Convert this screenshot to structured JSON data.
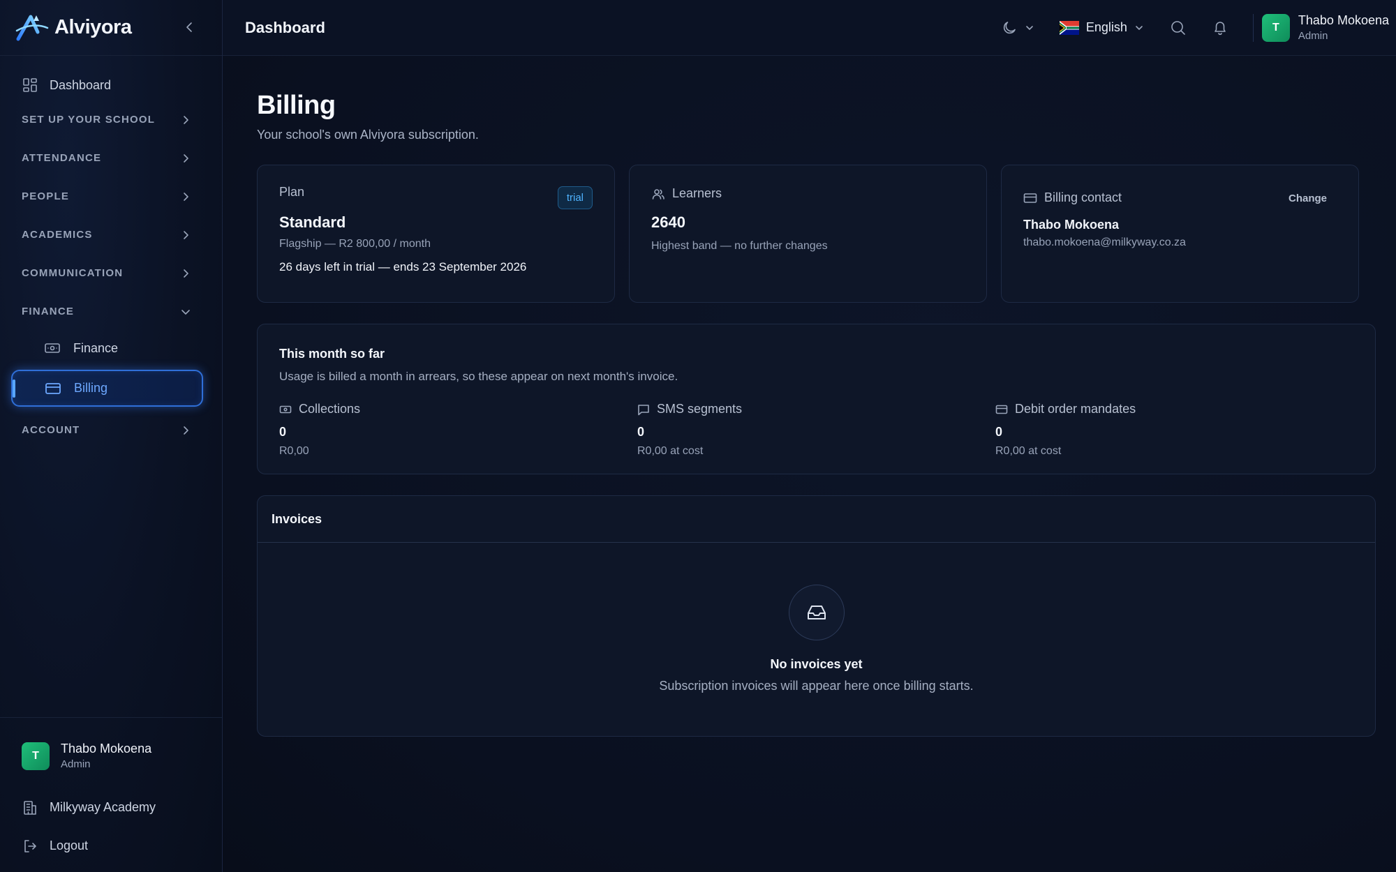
{
  "brand": {
    "name": "Alviyora"
  },
  "topbar": {
    "title": "Dashboard",
    "language": "English"
  },
  "user": {
    "name": "Thabo Mokoena",
    "role": "Admin",
    "initial": "T"
  },
  "sidebar": {
    "dashboard": "Dashboard",
    "sections": [
      {
        "label": "SET UP YOUR SCHOOL"
      },
      {
        "label": "ATTENDANCE"
      },
      {
        "label": "PEOPLE"
      },
      {
        "label": "ACADEMICS"
      },
      {
        "label": "COMMUNICATION"
      },
      {
        "label": "FINANCE"
      },
      {
        "label": "ACCOUNT"
      }
    ],
    "finance_items": [
      {
        "label": "Finance"
      },
      {
        "label": "Billing"
      }
    ],
    "footer": {
      "school": "Milkyway Academy",
      "logout": "Logout"
    }
  },
  "page": {
    "title": "Billing",
    "subtitle": "Your school's own Alviyora subscription."
  },
  "plan": {
    "label": "Plan",
    "badge": "trial",
    "name": "Standard",
    "price": "Flagship — R2 800,00 / month",
    "trial": "26 days left in trial — ends 23 September 2026"
  },
  "learners": {
    "label": "Learners",
    "count": "2640",
    "note": "Highest band — no further changes"
  },
  "contact": {
    "label": "Billing contact",
    "action": "Change",
    "name": "Thabo Mokoena",
    "email": "thabo.mokoena@milkyway.co.za"
  },
  "month": {
    "title": "This month so far",
    "subtitle": "Usage is billed a month in arrears, so these appear on next month's invoice.",
    "stats": [
      {
        "label": "Collections",
        "value": "0",
        "sub": "R0,00"
      },
      {
        "label": "SMS segments",
        "value": "0",
        "sub": "R0,00 at cost"
      },
      {
        "label": "Debit order mandates",
        "value": "0",
        "sub": "R0,00 at cost"
      }
    ]
  },
  "invoices": {
    "title": "Invoices",
    "empty_title": "No invoices yet",
    "empty_sub": "Subscription invoices will appear here once billing starts."
  }
}
